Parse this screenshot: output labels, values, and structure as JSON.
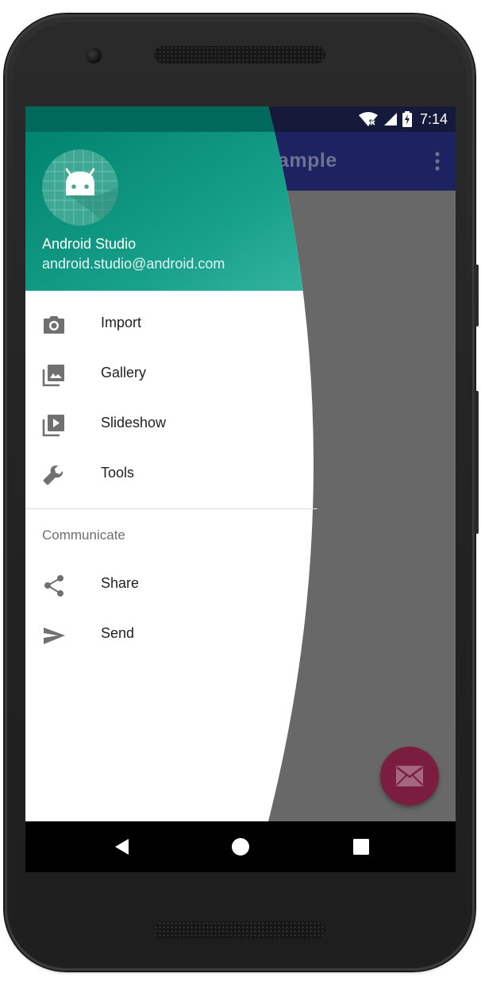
{
  "status_bar": {
    "time": "7:14",
    "notification_icon": "sync-circle-icon",
    "wifi_icon": "wifi-x-icon",
    "signal_icon": "cell-signal-icon",
    "battery_icon": "battery-charging-icon"
  },
  "app_bar": {
    "title": "ample",
    "overflow_icon": "more-vert-icon",
    "color": "#1d2260"
  },
  "drawer_header": {
    "avatar_icon": "android-logo-icon",
    "name": "Android Studio",
    "email": "android.studio@android.com",
    "gradient_start": "#00836f",
    "gradient_end": "#2bb29e"
  },
  "menu": {
    "items": [
      {
        "label": "Import",
        "icon": "camera-icon"
      },
      {
        "label": "Gallery",
        "icon": "gallery-icon"
      },
      {
        "label": "Slideshow",
        "icon": "slideshow-icon"
      },
      {
        "label": "Tools",
        "icon": "wrench-icon"
      }
    ],
    "section_header": "Communicate",
    "section_items": [
      {
        "label": "Share",
        "icon": "share-icon"
      },
      {
        "label": "Send",
        "icon": "send-icon"
      }
    ]
  },
  "fab": {
    "icon": "email-icon",
    "color": "#7a1d3e"
  },
  "nav_bar": {
    "back_icon": "back-triangle-icon",
    "home_icon": "home-circle-icon",
    "recents_icon": "recents-square-icon"
  }
}
